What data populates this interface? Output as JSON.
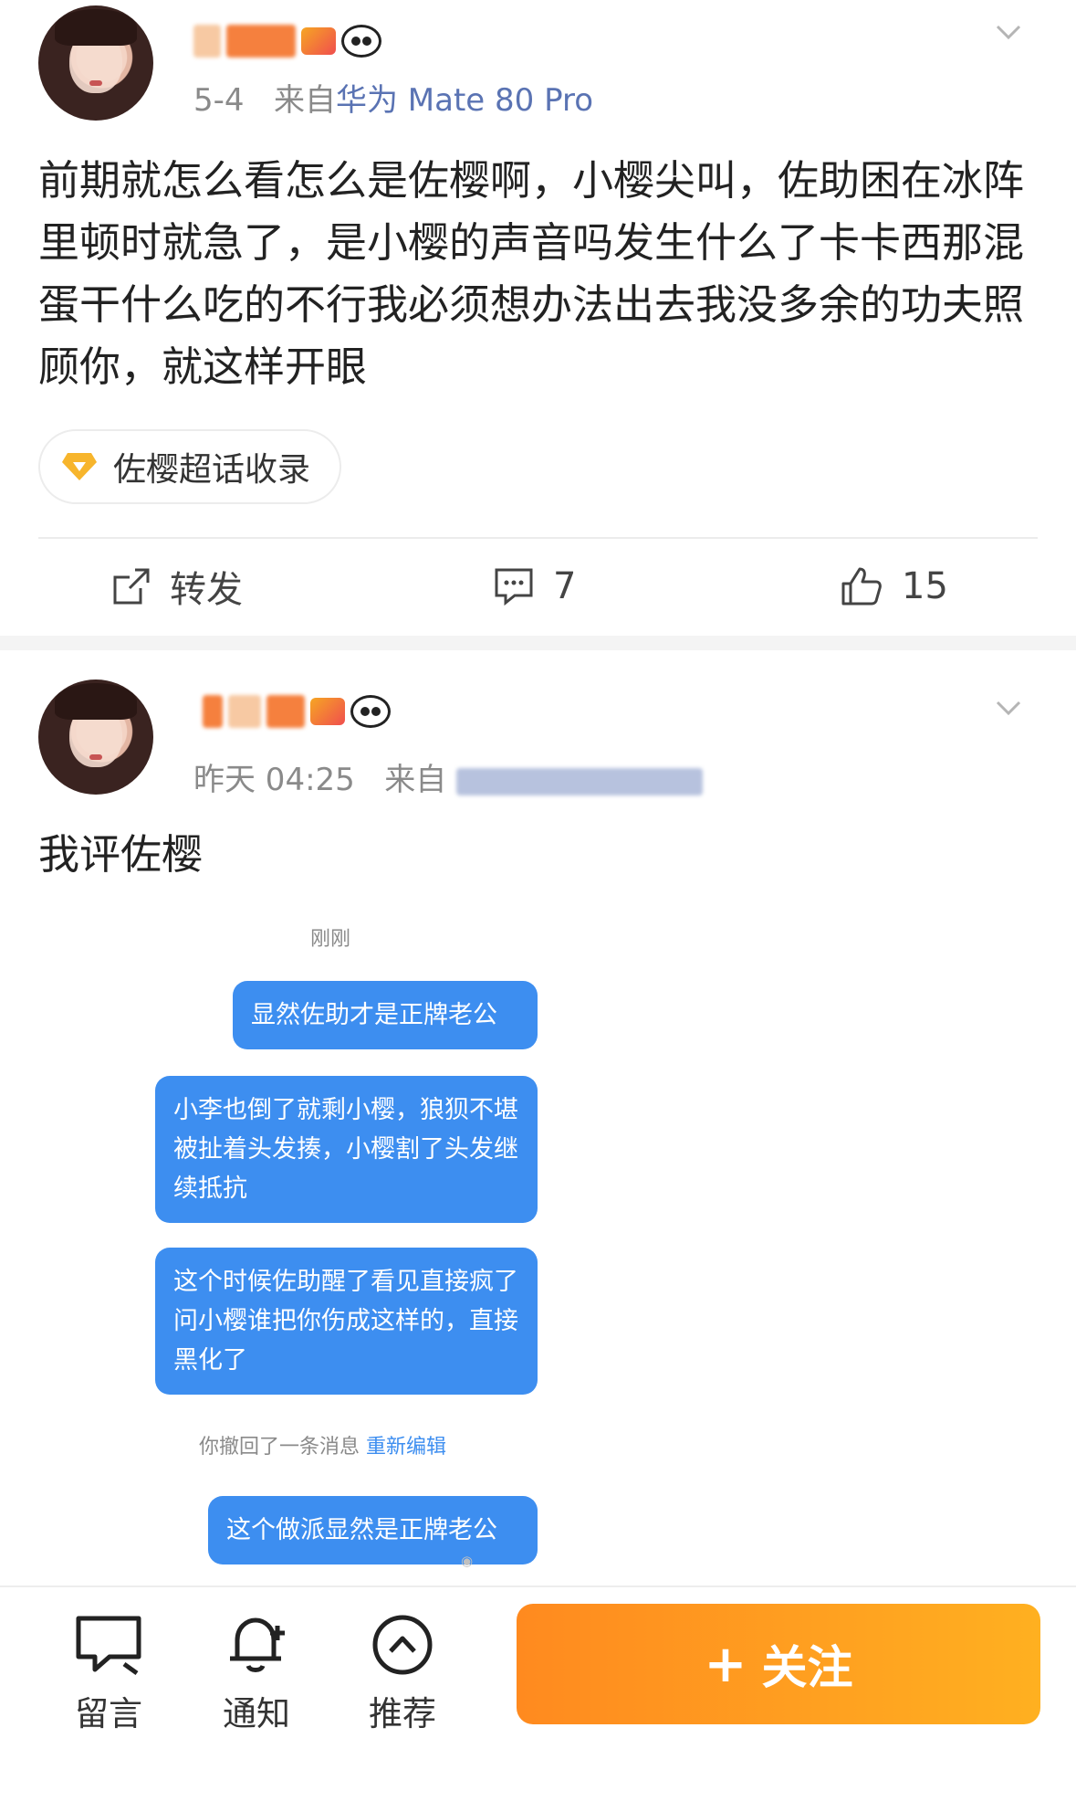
{
  "post1": {
    "meta_date": "5-4",
    "meta_from": "来自",
    "meta_device": "华为 Mate 80 Pro",
    "text": "前期就怎么看怎么是佐樱啊，小樱尖叫，佐助困在冰阵里顿时就急了，是小樱的声音吗发生什么了卡卡西那混蛋干什么吃的不行我必须想办法出去我没多余的功夫照顾你，就这样开眼",
    "topic": "佐樱超话收录",
    "actions": {
      "repost_label": "转发",
      "comment_count": "7",
      "like_count": "15"
    }
  },
  "post2": {
    "meta_date": "昨天 04:25",
    "meta_from": "来自",
    "text": "我评佐樱",
    "chat": {
      "time": "刚刚",
      "messages": [
        "显然佐助才是正牌老公",
        "小李也倒了就剩小樱，狼狈不堪被扯着头发揍，小樱割了头发继续抵抗",
        "这个时候佐助醒了看见直接疯了问小樱谁把你伤成这样的，直接黑化了",
        "这个做派显然是正牌老公"
      ],
      "recall_text": "你撤回了一条消息",
      "recall_link": "重新编辑"
    }
  },
  "bottom_bar": {
    "comment_label": "留言",
    "notify_label": "通知",
    "recommend_label": "推荐",
    "follow_label": "关注",
    "follow_plus": "+"
  },
  "colors": {
    "accent_orange": "#ff8a1f",
    "bubble_blue": "#3d8ef0",
    "meta_gray": "#8a8a8a",
    "source_blue": "#5a73b3"
  }
}
